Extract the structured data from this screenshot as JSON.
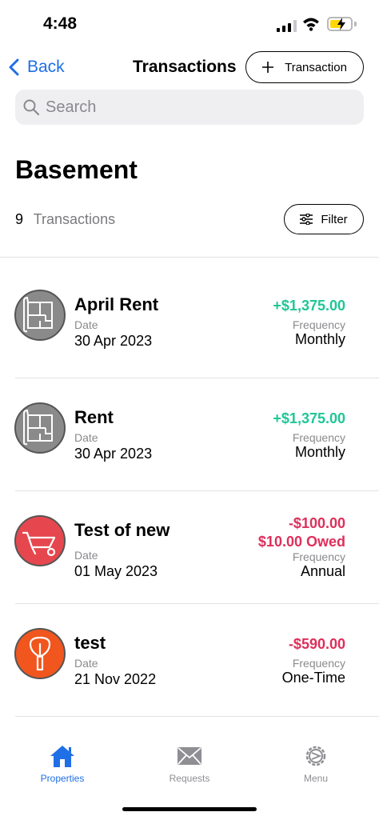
{
  "status_bar": {
    "time": "4:48"
  },
  "nav": {
    "back_label": "Back",
    "title": "Transactions",
    "add_label": "Transaction"
  },
  "search": {
    "placeholder": "Search"
  },
  "header": {
    "title": "Basement",
    "count": "9",
    "count_label": "Transactions",
    "filter_label": "Filter"
  },
  "colors": {
    "accent": "#1f6fe6",
    "positive": "#1fc795",
    "negative": "#de2f5b",
    "tab_inactive": "#8e8e93"
  },
  "transactions": [
    {
      "name": "April Rent",
      "date_label": "Date",
      "date": "30 Apr 2023",
      "amount": "+$1,375.00",
      "owed": "",
      "frequency_label": "Frequency",
      "frequency": "Monthly",
      "icon": "floor-plan-icon",
      "kind": "income"
    },
    {
      "name": "Rent",
      "date_label": "Date",
      "date": "30 Apr 2023",
      "amount": "+$1,375.00",
      "owed": "",
      "frequency_label": "Frequency",
      "frequency": "Monthly",
      "icon": "floor-plan-icon",
      "kind": "income"
    },
    {
      "name": "Test of new",
      "date_label": "Date",
      "date": "01 May 2023",
      "amount": "-$100.00",
      "owed": "$10.00 Owed",
      "frequency_label": "Frequency",
      "frequency": "Annual",
      "icon": "wheelbarrow-icon",
      "kind": "expense"
    },
    {
      "name": "test",
      "date_label": "Date",
      "date": "21 Nov 2022",
      "amount": "-$590.00",
      "owed": "",
      "frequency_label": "Frequency",
      "frequency": "One-Time",
      "icon": "trowel-icon",
      "kind": "expense"
    }
  ],
  "tabs": [
    {
      "label": "Properties",
      "icon": "house-icon",
      "active": true
    },
    {
      "label": "Requests",
      "icon": "envelope-icon",
      "active": false
    },
    {
      "label": "Menu",
      "icon": "gear-icon",
      "active": false
    }
  ]
}
